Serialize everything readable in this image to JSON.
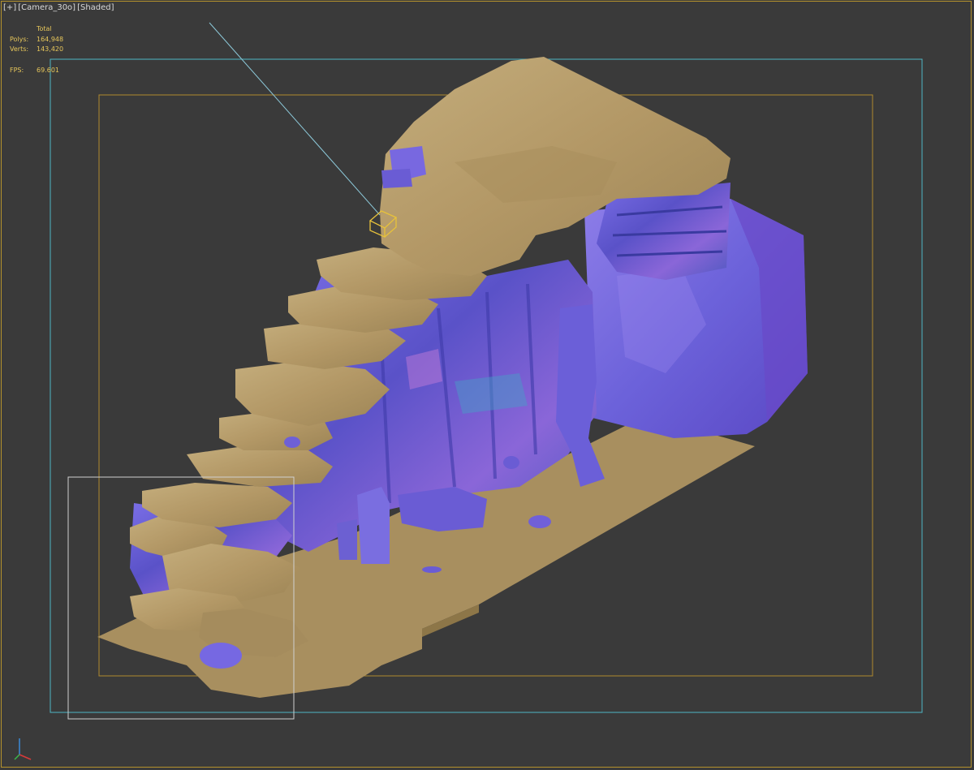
{
  "viewport_label": {
    "plus": "[+]",
    "camera": "[Camera_30o]",
    "mode": "[Shaded]"
  },
  "stats": {
    "total_label": "Total",
    "polys_label": "Polys:",
    "polys_value": "164,948",
    "verts_label": "Verts:",
    "verts_value": "143,420",
    "fps_label": "FPS:",
    "fps_value": "69.601"
  },
  "colors": {
    "viewport_bg": "#3a3a3a",
    "active_frame": "#b4922d",
    "safe_frame_outer": "#4fb7c4",
    "safe_frame_inner": "#b08a2e",
    "region_box": "#d0d0d0",
    "sand": "#b49a6a",
    "rock": "#6a5fd0",
    "stats_text": "#e6c65a"
  },
  "icons": {
    "camera_target": "wireframe-cube-icon",
    "axis_gizmo": "axis-tripod-icon"
  }
}
